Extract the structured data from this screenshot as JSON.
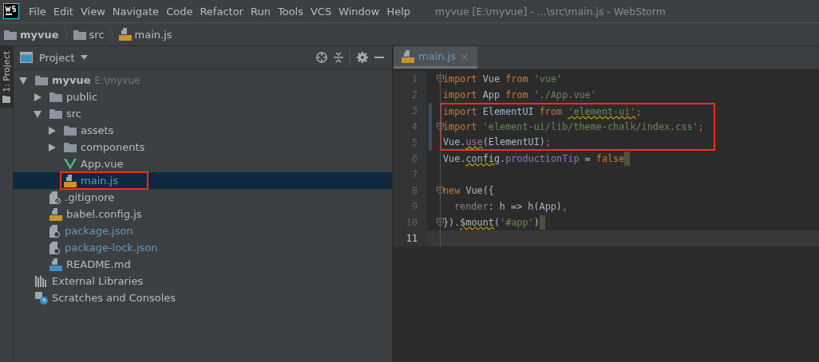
{
  "window": {
    "title": "myvue [E:\\myvue] - ...\\src\\main.js - WebStorm"
  },
  "menu": [
    "File",
    "Edit",
    "View",
    "Navigate",
    "Code",
    "Refactor",
    "Run",
    "Tools",
    "VCS",
    "Window",
    "Help"
  ],
  "breadcrumbs": [
    {
      "label": "myvue",
      "kind": "folder"
    },
    {
      "label": "src",
      "kind": "folder"
    },
    {
      "label": "main.js",
      "kind": "js"
    }
  ],
  "side_tab": {
    "label": "1: Project",
    "selected": true
  },
  "project_panel": {
    "title": "Project",
    "tree": [
      {
        "name": "myvue",
        "hint": "E:\\myvue",
        "kind": "folder",
        "expanded": true,
        "selected": false,
        "boxed": false,
        "color": "#bbbbbb",
        "children": [
          {
            "name": "public",
            "kind": "folder",
            "expanded": false,
            "selected": false,
            "boxed": false,
            "color": "#bbbbbb"
          },
          {
            "name": "src",
            "kind": "folder",
            "expanded": true,
            "selected": false,
            "boxed": false,
            "color": "#bbbbbb",
            "children": [
              {
                "name": "assets",
                "kind": "folder",
                "expanded": false,
                "selected": false,
                "boxed": false,
                "color": "#bbbbbb"
              },
              {
                "name": "components",
                "kind": "folder",
                "expanded": false,
                "selected": false,
                "boxed": false,
                "color": "#bbbbbb"
              },
              {
                "name": "App.vue",
                "kind": "vue",
                "selected": false,
                "boxed": false,
                "color": "#bbbbbb"
              },
              {
                "name": "main.js",
                "kind": "js",
                "selected": true,
                "boxed": true,
                "color": "#6897bb"
              }
            ]
          },
          {
            "name": ".gitignore",
            "kind": "ignore",
            "selected": false,
            "boxed": false,
            "color": "#bbbbbb"
          },
          {
            "name": "babel.config.js",
            "kind": "js",
            "selected": false,
            "boxed": false,
            "color": "#bbbbbb"
          },
          {
            "name": "package.json",
            "kind": "json",
            "selected": false,
            "boxed": false,
            "color": "#6897bb"
          },
          {
            "name": "package-lock.json",
            "kind": "json",
            "selected": false,
            "boxed": false,
            "color": "#6897bb"
          },
          {
            "name": "README.md",
            "kind": "md",
            "selected": false,
            "boxed": false,
            "color": "#bbbbbb"
          }
        ]
      },
      {
        "name": "External Libraries",
        "kind": "libraries",
        "selected": false,
        "boxed": false,
        "color": "#bbbbbb"
      },
      {
        "name": "Scratches and Consoles",
        "kind": "scratches",
        "selected": false,
        "boxed": false,
        "color": "#bbbbbb"
      }
    ]
  },
  "editor": {
    "tabs": [
      {
        "label": "main.js",
        "kind": "js",
        "selected": true,
        "close": "×"
      }
    ],
    "lines": [
      {
        "number": "1",
        "fold": true,
        "changed": false,
        "boxed": false,
        "current": false,
        "end_marker": false,
        "tokens": [
          {
            "text": "import",
            "kind": "keyword",
            "underlined": false
          },
          {
            "text": " Vue ",
            "kind": "plain",
            "underlined": false
          },
          {
            "text": "from",
            "kind": "keyword",
            "underlined": false
          },
          {
            "text": " 'vue'",
            "kind": "string",
            "underlined": false
          }
        ]
      },
      {
        "number": "2",
        "fold": false,
        "changed": false,
        "boxed": false,
        "current": false,
        "end_marker": false,
        "tokens": [
          {
            "text": "import",
            "kind": "keyword",
            "underlined": false
          },
          {
            "text": " App ",
            "kind": "plain",
            "underlined": false
          },
          {
            "text": "from",
            "kind": "keyword",
            "underlined": false
          },
          {
            "text": " './App.vue'",
            "kind": "string",
            "underlined": false
          }
        ]
      },
      {
        "number": "3",
        "fold": false,
        "changed": true,
        "boxed": true,
        "current": false,
        "end_marker": false,
        "tokens": [
          {
            "text": "import",
            "kind": "keyword",
            "underlined": false
          },
          {
            "text": " ElementUI ",
            "kind": "plain",
            "underlined": false
          },
          {
            "text": "from ",
            "kind": "keyword",
            "underlined": false
          },
          {
            "text": "'element-ui'",
            "kind": "string",
            "underlined": true
          },
          {
            "text": ";",
            "kind": "keyword",
            "underlined": false
          }
        ]
      },
      {
        "number": "4",
        "fold": true,
        "changed": true,
        "boxed": true,
        "current": false,
        "end_marker": false,
        "tokens": [
          {
            "text": "import ",
            "kind": "keyword",
            "underlined": false
          },
          {
            "text": "'element-ui/lib/theme-chalk/index.css'",
            "kind": "string",
            "underlined": false
          },
          {
            "text": ";",
            "kind": "keyword",
            "underlined": false
          }
        ]
      },
      {
        "number": "5",
        "fold": false,
        "changed": true,
        "boxed": true,
        "current": false,
        "end_marker": false,
        "tokens": [
          {
            "text": "Vue.",
            "kind": "plain",
            "underlined": false
          },
          {
            "text": "use",
            "kind": "property",
            "underlined": true
          },
          {
            "text": "(ElementUI)",
            "kind": "plain",
            "underlined": false
          },
          {
            "text": ";",
            "kind": "keyword",
            "underlined": false
          }
        ]
      },
      {
        "number": "6",
        "fold": false,
        "changed": false,
        "boxed": false,
        "current": false,
        "end_marker": true,
        "tokens": [
          {
            "text": "Vue.",
            "kind": "plain",
            "underlined": false
          },
          {
            "text": "config",
            "kind": "plain",
            "underlined": true
          },
          {
            "text": ".",
            "kind": "plain",
            "underlined": false
          },
          {
            "text": "productionTip",
            "kind": "property",
            "underlined": false
          },
          {
            "text": " = ",
            "kind": "plain",
            "underlined": false
          },
          {
            "text": "false",
            "kind": "keyword",
            "underlined": false
          }
        ]
      },
      {
        "number": "7",
        "fold": false,
        "changed": false,
        "boxed": false,
        "current": false,
        "end_marker": false
      },
      {
        "number": "8",
        "fold": true,
        "changed": false,
        "boxed": false,
        "current": false,
        "end_marker": false,
        "tokens": [
          {
            "text": "new",
            "kind": "keyword",
            "underlined": false
          },
          {
            "text": " Vue({",
            "kind": "plain",
            "underlined": false
          }
        ]
      },
      {
        "number": "9",
        "fold": false,
        "changed": false,
        "boxed": false,
        "current": false,
        "end_marker": false,
        "tokens": [
          {
            "text": "render",
            "kind": "param",
            "underlined": false
          },
          {
            "text": ": h => h(App)",
            "kind": "plain",
            "underlined": false
          },
          {
            "text": ",",
            "kind": "keyword",
            "underlined": false
          }
        ]
      },
      {
        "number": "10",
        "fold": true,
        "changed": false,
        "boxed": false,
        "current": false,
        "end_marker": true,
        "tokens": [
          {
            "text": "}).",
            "kind": "plain",
            "underlined": false
          },
          {
            "text": "$mount",
            "kind": "plain",
            "underlined": true
          },
          {
            "text": "(",
            "kind": "plain",
            "underlined": false
          },
          {
            "text": "'#app'",
            "kind": "string",
            "underlined": false
          },
          {
            "text": ")",
            "kind": "plain",
            "underlined": false
          }
        ]
      },
      {
        "number": "11",
        "fold": false,
        "changed": false,
        "boxed": false,
        "current": true,
        "end_marker": false
      }
    ]
  }
}
